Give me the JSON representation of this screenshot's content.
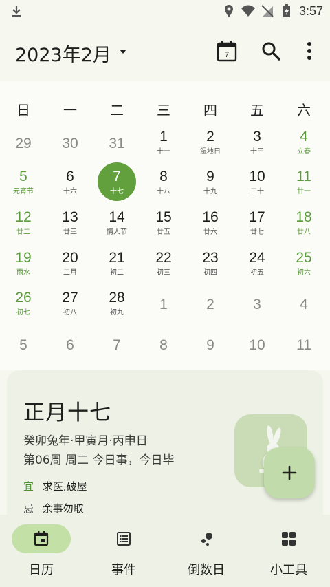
{
  "status": {
    "time": "3:57"
  },
  "header": {
    "title": "2023年2月"
  },
  "weekdays": [
    "日",
    "一",
    "二",
    "三",
    "四",
    "五",
    "六"
  ],
  "weeks": [
    [
      {
        "num": "29",
        "lunar": "",
        "kind": "other"
      },
      {
        "num": "30",
        "lunar": "",
        "kind": "other"
      },
      {
        "num": "31",
        "lunar": "",
        "kind": "other"
      },
      {
        "num": "1",
        "lunar": "十一",
        "kind": "normal"
      },
      {
        "num": "2",
        "lunar": "湿地日",
        "kind": "normal"
      },
      {
        "num": "3",
        "lunar": "十三",
        "kind": "normal"
      },
      {
        "num": "4",
        "lunar": "立春",
        "kind": "weekend"
      }
    ],
    [
      {
        "num": "5",
        "lunar": "元宵节",
        "kind": "weekend"
      },
      {
        "num": "6",
        "lunar": "十六",
        "kind": "normal"
      },
      {
        "num": "7",
        "lunar": "十七",
        "kind": "today"
      },
      {
        "num": "8",
        "lunar": "十八",
        "kind": "normal"
      },
      {
        "num": "9",
        "lunar": "十九",
        "kind": "normal"
      },
      {
        "num": "10",
        "lunar": "二十",
        "kind": "normal"
      },
      {
        "num": "11",
        "lunar": "廿一",
        "kind": "weekend"
      }
    ],
    [
      {
        "num": "12",
        "lunar": "廿二",
        "kind": "weekend"
      },
      {
        "num": "13",
        "lunar": "廿三",
        "kind": "normal"
      },
      {
        "num": "14",
        "lunar": "情人节",
        "kind": "normal"
      },
      {
        "num": "15",
        "lunar": "廿五",
        "kind": "normal"
      },
      {
        "num": "16",
        "lunar": "廿六",
        "kind": "normal"
      },
      {
        "num": "17",
        "lunar": "廿七",
        "kind": "normal"
      },
      {
        "num": "18",
        "lunar": "廿八",
        "kind": "weekend"
      }
    ],
    [
      {
        "num": "19",
        "lunar": "雨水",
        "kind": "weekend"
      },
      {
        "num": "20",
        "lunar": "二月",
        "kind": "normal"
      },
      {
        "num": "21",
        "lunar": "初二",
        "kind": "normal"
      },
      {
        "num": "22",
        "lunar": "初三",
        "kind": "normal"
      },
      {
        "num": "23",
        "lunar": "初四",
        "kind": "normal"
      },
      {
        "num": "24",
        "lunar": "初五",
        "kind": "normal"
      },
      {
        "num": "25",
        "lunar": "初六",
        "kind": "weekend"
      }
    ],
    [
      {
        "num": "26",
        "lunar": "初七",
        "kind": "weekend"
      },
      {
        "num": "27",
        "lunar": "初八",
        "kind": "normal"
      },
      {
        "num": "28",
        "lunar": "初九",
        "kind": "normal"
      },
      {
        "num": "1",
        "lunar": "",
        "kind": "other"
      },
      {
        "num": "2",
        "lunar": "",
        "kind": "other"
      },
      {
        "num": "3",
        "lunar": "",
        "kind": "other"
      },
      {
        "num": "4",
        "lunar": "",
        "kind": "other"
      }
    ],
    [
      {
        "num": "5",
        "lunar": "",
        "kind": "other"
      },
      {
        "num": "6",
        "lunar": "",
        "kind": "other"
      },
      {
        "num": "7",
        "lunar": "",
        "kind": "other"
      },
      {
        "num": "8",
        "lunar": "",
        "kind": "other"
      },
      {
        "num": "9",
        "lunar": "",
        "kind": "other"
      },
      {
        "num": "10",
        "lunar": "",
        "kind": "other"
      },
      {
        "num": "11",
        "lunar": "",
        "kind": "other"
      }
    ]
  ],
  "detail": {
    "lunar_date": "正月十七",
    "ganzhi": "癸卯兔年·甲寅月·丙申日",
    "week_info": "第06周 周二 今日事，今日毕",
    "yi_label": "宜",
    "yi_text": "求医,破屋",
    "ji_label": "忌",
    "ji_text": "余事勿取"
  },
  "nav": [
    {
      "label": "日历",
      "icon": "calendar-today-icon",
      "active": true
    },
    {
      "label": "事件",
      "icon": "list-icon",
      "active": false
    },
    {
      "label": "倒数日",
      "icon": "countdown-icon",
      "active": false
    },
    {
      "label": "小工具",
      "icon": "widgets-icon",
      "active": false
    }
  ],
  "colors": {
    "accent": "#62a03d",
    "weekend": "#5a9b3b",
    "nav_pill": "#c3e0a6",
    "fab": "#c2dbaa"
  },
  "today_badge": "7"
}
